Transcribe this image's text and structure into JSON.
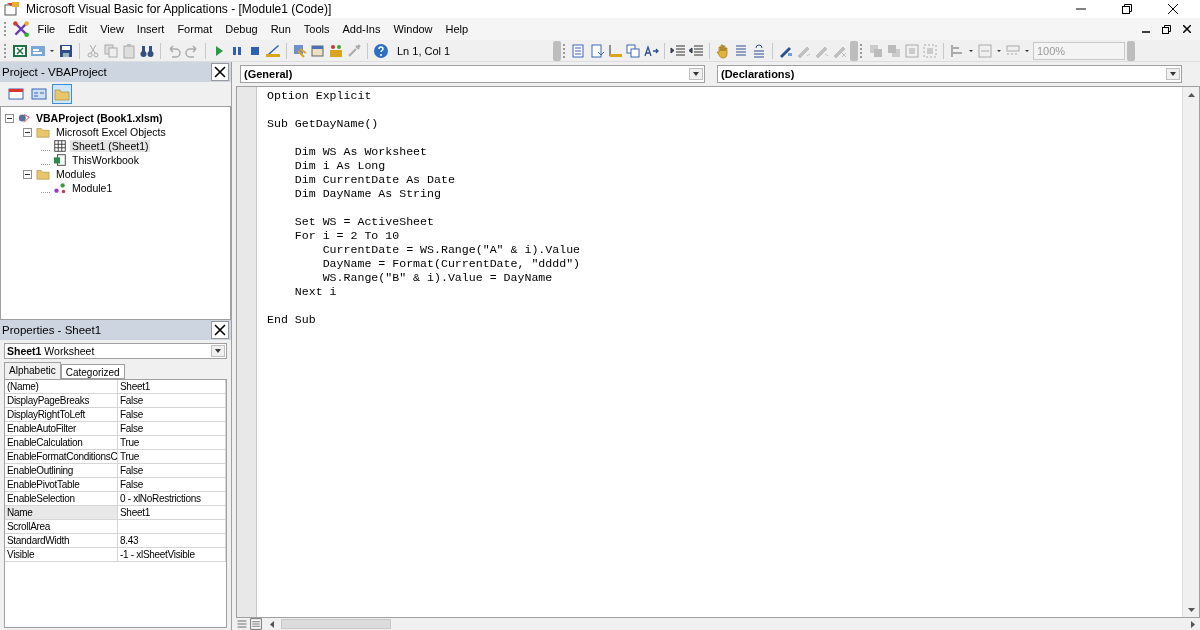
{
  "window": {
    "title": "Microsoft Visual Basic for Applications - [Module1 (Code)]"
  },
  "menu": [
    "File",
    "Edit",
    "View",
    "Insert",
    "Format",
    "Debug",
    "Run",
    "Tools",
    "Add-Ins",
    "Window",
    "Help"
  ],
  "toolbar": {
    "position": "Ln 1, Col 1",
    "zoom": "100%"
  },
  "project": {
    "title": "Project - VBAProject",
    "toggle_folders": {
      "pressed": true
    },
    "tree": [
      {
        "label": "VBAProject (Book1.xlsm)",
        "kind": "project",
        "expanded": true,
        "selected": false,
        "children": [
          {
            "label": "Microsoft Excel Objects",
            "kind": "folder",
            "expanded": true,
            "selected": false,
            "children": [
              {
                "label": "Sheet1 (Sheet1)",
                "kind": "sheet",
                "selected": true
              },
              {
                "label": "ThisWorkbook",
                "kind": "workbook",
                "selected": false
              }
            ]
          },
          {
            "label": "Modules",
            "kind": "folder",
            "expanded": true,
            "selected": false,
            "children": [
              {
                "label": "Module1",
                "kind": "module",
                "selected": false
              }
            ]
          }
        ]
      }
    ]
  },
  "properties": {
    "title": "Properties - Sheet1",
    "object": {
      "name": "Sheet1",
      "type": "Worksheet"
    },
    "tabs": [
      {
        "label": "Alphabetic",
        "selected": true
      },
      {
        "label": "Categorized",
        "selected": false
      }
    ],
    "rows": [
      {
        "name": "(Name)",
        "value": "Sheet1",
        "selected": false
      },
      {
        "name": "DisplayPageBreaks",
        "value": "False",
        "selected": false
      },
      {
        "name": "DisplayRightToLeft",
        "value": "False",
        "selected": false
      },
      {
        "name": "EnableAutoFilter",
        "value": "False",
        "selected": false
      },
      {
        "name": "EnableCalculation",
        "value": "True",
        "selected": false
      },
      {
        "name": "EnableFormatConditionsC",
        "value": "True",
        "selected": false
      },
      {
        "name": "EnableOutlining",
        "value": "False",
        "selected": false
      },
      {
        "name": "EnablePivotTable",
        "value": "False",
        "selected": false
      },
      {
        "name": "EnableSelection",
        "value": "0 - xlNoRestrictions",
        "selected": false
      },
      {
        "name": "Name",
        "value": "Sheet1",
        "selected": true
      },
      {
        "name": "ScrollArea",
        "selected": false
      },
      {
        "name": "StandardWidth",
        "value": "8.43",
        "selected": false
      },
      {
        "name": "Visible",
        "value": "-1 - xlSheetVisible",
        "selected": false
      }
    ]
  },
  "code": {
    "object": "(General)",
    "procedure": "(Declarations)",
    "blocks": [
      [
        "Option Explicit"
      ],
      [
        "Sub GetDayName()"
      ],
      [
        "    Dim WS As Worksheet",
        "    Dim i As Long",
        "    Dim CurrentDate As Date",
        "    Dim DayName As String"
      ],
      [
        "    Set WS = ActiveSheet",
        "    For i = 2 To 10",
        "        CurrentDate = WS.Range(\"A\" & i).Value",
        "        DayName = Format(CurrentDate, \"dddd\")",
        "        WS.Range(\"B\" & i).Value = DayName",
        "    Next i"
      ],
      [
        "End Sub"
      ]
    ]
  }
}
